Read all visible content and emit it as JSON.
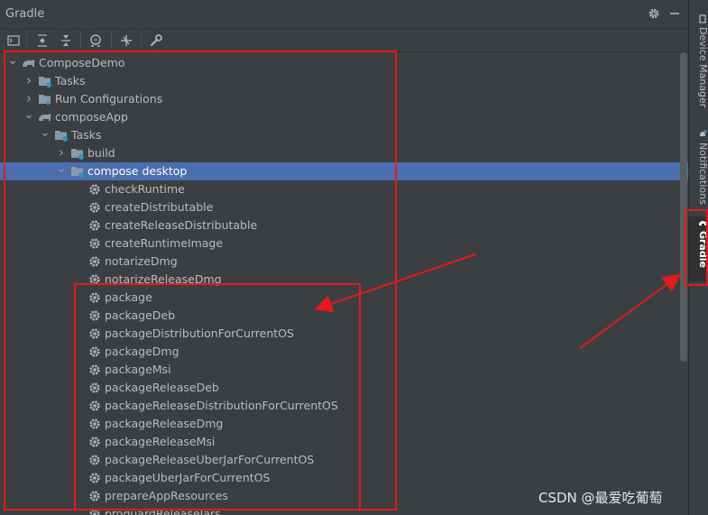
{
  "panel": {
    "title": "Gradle"
  },
  "toolbar": {
    "buttons": [
      "terminal-icon",
      "expand-all-icon",
      "collapse-all-icon",
      "analyze-icon",
      "toggle-offline-icon",
      "settings-wrench-icon"
    ]
  },
  "tree": {
    "rows": [
      {
        "label": "ComposeDemo",
        "level": 0,
        "arrow": "down",
        "icon": "gradle-elephant-icon"
      },
      {
        "label": "Tasks",
        "level": 1,
        "arrow": "right",
        "icon": "task-folder-icon"
      },
      {
        "label": "Run Configurations",
        "level": 1,
        "arrow": "right",
        "icon": "run-config-folder-icon"
      },
      {
        "label": "composeApp",
        "level": 1,
        "arrow": "down",
        "icon": "gradle-elephant-icon"
      },
      {
        "label": "Tasks",
        "level": 2,
        "arrow": "down",
        "icon": "task-folder-icon"
      },
      {
        "label": "build",
        "level": 3,
        "arrow": "right",
        "icon": "task-folder-icon"
      },
      {
        "label": "compose desktop",
        "level": 3,
        "arrow": "down",
        "icon": "task-folder-icon",
        "selected": true
      },
      {
        "label": "checkRuntime",
        "level": 4,
        "icon": "gear-icon"
      },
      {
        "label": "createDistributable",
        "level": 4,
        "icon": "gear-icon"
      },
      {
        "label": "createReleaseDistributable",
        "level": 4,
        "icon": "gear-icon"
      },
      {
        "label": "createRuntimeImage",
        "level": 4,
        "icon": "gear-icon"
      },
      {
        "label": "notarizeDmg",
        "level": 4,
        "icon": "gear-icon"
      },
      {
        "label": "notarizeReleaseDmg",
        "level": 4,
        "icon": "gear-icon"
      },
      {
        "label": "package",
        "level": 4,
        "icon": "gear-icon"
      },
      {
        "label": "packageDeb",
        "level": 4,
        "icon": "gear-icon"
      },
      {
        "label": "packageDistributionForCurrentOS",
        "level": 4,
        "icon": "gear-icon"
      },
      {
        "label": "packageDmg",
        "level": 4,
        "icon": "gear-icon"
      },
      {
        "label": "packageMsi",
        "level": 4,
        "icon": "gear-icon"
      },
      {
        "label": "packageReleaseDeb",
        "level": 4,
        "icon": "gear-icon"
      },
      {
        "label": "packageReleaseDistributionForCurrentOS",
        "level": 4,
        "icon": "gear-icon"
      },
      {
        "label": "packageReleaseDmg",
        "level": 4,
        "icon": "gear-icon"
      },
      {
        "label": "packageReleaseMsi",
        "level": 4,
        "icon": "gear-icon"
      },
      {
        "label": "packageReleaseUberJarForCurrentOS",
        "level": 4,
        "icon": "gear-icon"
      },
      {
        "label": "packageUberJarForCurrentOS",
        "level": 4,
        "icon": "gear-icon"
      },
      {
        "label": "prepareAppResources",
        "level": 4,
        "icon": "gear-icon"
      },
      {
        "label": "proguardReleaseJars",
        "level": 4,
        "icon": "gear-icon"
      }
    ]
  },
  "side_tabs": [
    {
      "label": "Device Manager",
      "icon": "device-icon"
    },
    {
      "label": "Notifications",
      "icon": "bell-icon"
    },
    {
      "label": "Gradle",
      "icon": "gradle-elephant-icon",
      "active": true
    }
  ],
  "watermark": "CSDN @最爱吃葡萄",
  "colors": {
    "background": "#3c3f41",
    "selection": "#4b6eaf",
    "annotation": "#e31b1b",
    "gear": "#a9b7c6",
    "folder": "#8a9aa8",
    "badge": "#3592c4"
  }
}
